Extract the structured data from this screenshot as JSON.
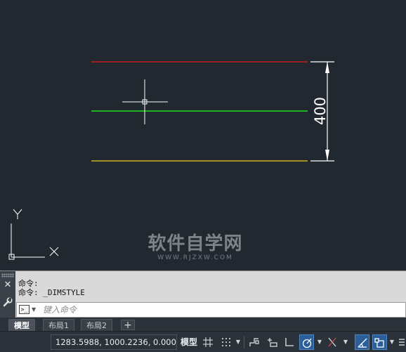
{
  "drawing": {
    "dimension_value": "400",
    "ucs_x": "X",
    "ucs_y": "Y",
    "colors": {
      "red_line": "#c41e1e",
      "green_line": "#1fb31f",
      "yellow_line": "#c9b51e",
      "dimension": "#ffffff",
      "background": "#212830"
    }
  },
  "watermark": {
    "main": "软件自学网",
    "sub": "WWW.RJZXW.COM"
  },
  "command": {
    "history": [
      "命令:",
      "命令: _DIMSTYLE"
    ],
    "placeholder": "键入命令",
    "prompt_icon": ">_"
  },
  "tabs": [
    {
      "label": "模型",
      "active": true
    },
    {
      "label": "布局1",
      "active": false
    },
    {
      "label": "布局2",
      "active": false
    }
  ],
  "tab_add": "+",
  "statusbar": {
    "coordinates": "1283.5988, 1000.2236, 0.0000",
    "model_label": "模型"
  }
}
